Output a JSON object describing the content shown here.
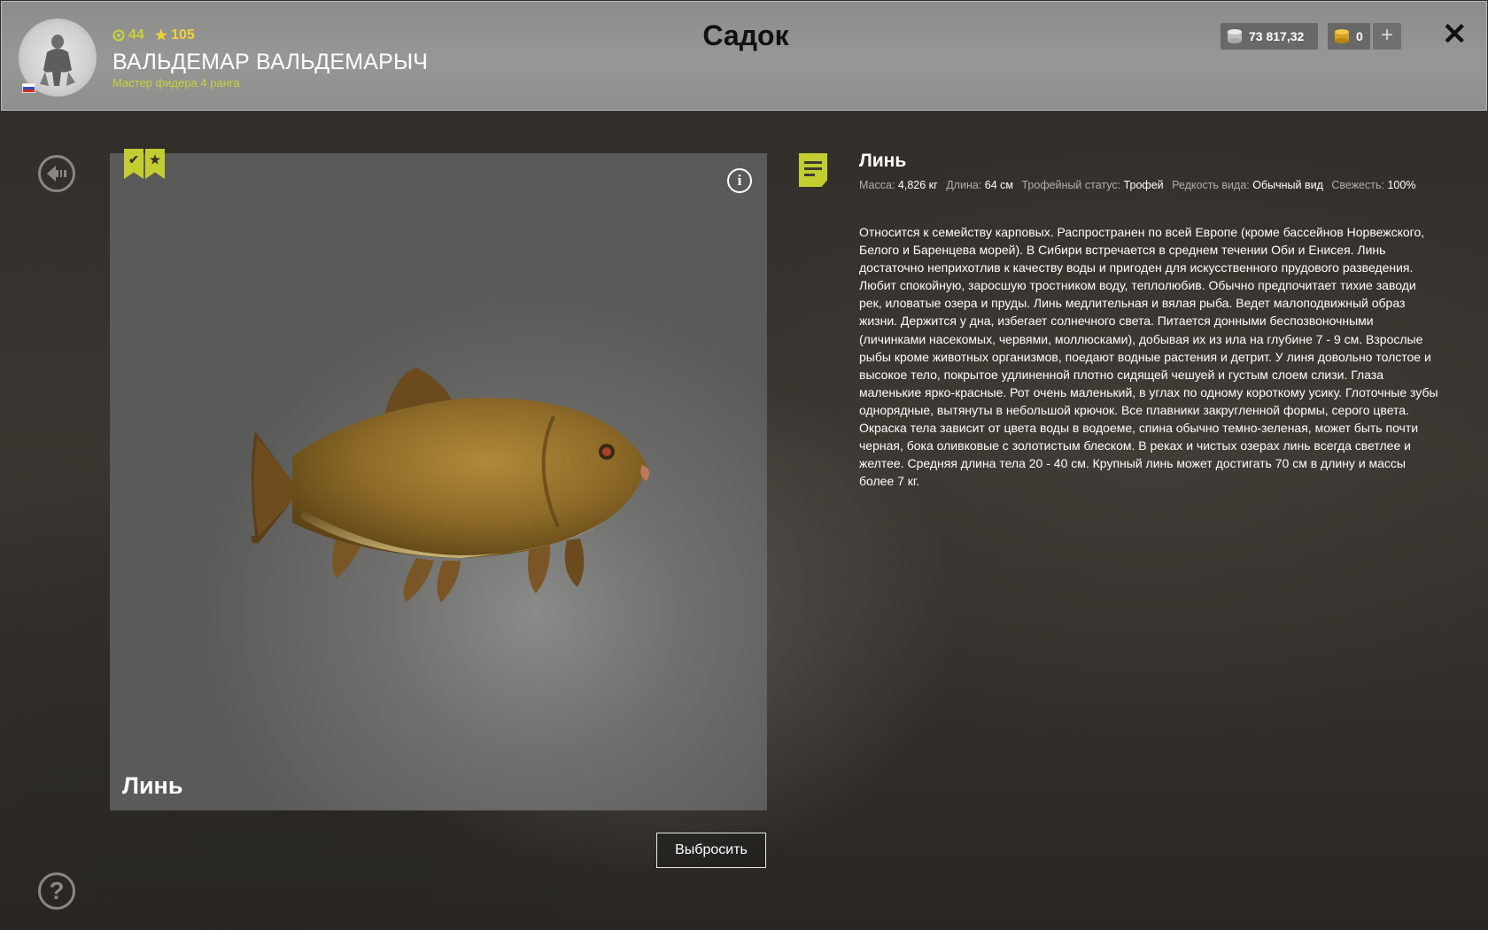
{
  "header": {
    "level": "44",
    "rating": "105",
    "player_name": "ВАЛЬДЕМАР ВАЛЬДЕМАРЫЧ",
    "player_title": "Мастер фидера 4 ранга",
    "page_title": "Садок",
    "silver": "73 817,32",
    "gold": "0",
    "add_label": "+",
    "close_label": "✕"
  },
  "fish": {
    "caption": "Линь",
    "name": "Линь",
    "info_label": "i",
    "discard_label": "Выбросить",
    "meta": {
      "mass_label": "Масса:",
      "mass": "4,826 кг",
      "length_label": "Длина:",
      "length": "64 см",
      "trophy_label": "Трофейный статус:",
      "trophy": "Трофей",
      "rarity_label": "Редкость вида:",
      "rarity": "Обычный вид",
      "freshness_label": "Свежесть:",
      "freshness": "100%"
    },
    "description": "Относится к семейству карповых. Распространен по всей Европе (кроме бассейнов Норвежского, Белого и Баренцева морей). В Сибири встречается в среднем течении Оби и Енисея. Линь достаточно неприхотлив к качеству воды и пригоден для искусственного прудового разведения. Любит спокойную, заросшую тростником воду, теплолюбив. Обычно предпочитает тихие заводи рек, иловатые озера и пруды. Линь медлительная и вялая рыба. Ведет малоподвижный образ жизни. Держится у дна, избегает солнечного света. Питается донными беспозвоночными (личинками насекомых, червями, моллюсками), добывая их из ила на глубине 7 - 9 см. Взрослые рыбы кроме животных организмов, поедают водные растения и детрит. У линя довольно толстое и высокое тело, покрытое удлиненной плотно сидящей чешуей и густым слоем слизи. Глаза маленькие ярко-красные. Рот очень маленький, в углах по одному короткому усику. Глоточные зубы однорядные, вытянуты в небольшой крючок. Все плавники закругленной формы, серого цвета. Окраска тела зависит от цвета воды в водоеме, спина обычно темно-зеленая, может быть почти черная, бока оливковые с золотистым блеском. В реках и чистых озерах линь всегда светлее и желтее. Средняя длина тела 20 - 40 см. Крупный линь может достигать 70 см в длину и массы более 7 кг."
  },
  "help_label": "?",
  "colors": {
    "accent": "#c3cd2f",
    "rating": "#f2d136",
    "header_bg": "#939391"
  },
  "icons": {
    "back": "back-arrow-icon",
    "help": "help-icon",
    "info": "info-icon",
    "document": "document-icon",
    "badge_check": "check-badge-icon",
    "badge_star": "star-badge-icon"
  }
}
